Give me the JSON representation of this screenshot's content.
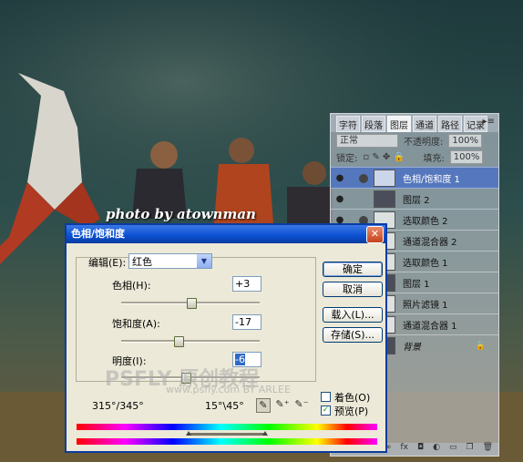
{
  "photo_caption": "photo by atownman",
  "watermark": {
    "brand": "PSFLY 原创教程",
    "url": "www.psfly.com",
    "author": "BY ARLEE"
  },
  "layers_panel": {
    "tabs": [
      "字符",
      "段落",
      "图层",
      "通道",
      "路径",
      "记录"
    ],
    "blend_mode": "正常",
    "opacity_label": "不透明度:",
    "opacity_value": "100%",
    "lock_label": "锁定:",
    "fill_label": "填充:",
    "fill_value": "100%",
    "layers": [
      {
        "name": "色相/饱和度 1",
        "selected": true
      },
      {
        "name": "图层 2",
        "selected": false
      },
      {
        "name": "选取颜色 2",
        "selected": false
      },
      {
        "name": "通道混合器 2",
        "selected": false
      },
      {
        "name": "选取颜色 1",
        "selected": false
      },
      {
        "name": "图层 1",
        "selected": false
      },
      {
        "name": "照片滤镜 1",
        "selected": false
      },
      {
        "name": "通道混合器 1",
        "selected": false
      },
      {
        "name": "背景",
        "selected": false
      }
    ]
  },
  "dialog": {
    "title": "色相/饱和度",
    "edit_label": "编辑(E):",
    "edit_value": "红色",
    "hue_label": "色相(H):",
    "hue_value": "+3",
    "hue_position": 0.508,
    "saturation_label": "饱和度(A):",
    "saturation_value": "-17",
    "saturation_position": 0.415,
    "lightness_label": "明度(I):",
    "lightness_value": "-6",
    "lightness_position": 0.47,
    "buttons": {
      "ok": "确定",
      "cancel": "取消",
      "load": "载入(L)...",
      "save": "存储(S)..."
    },
    "colorize_label": "着色(O)",
    "colorize_checked": false,
    "preview_label": "预览(P)",
    "preview_checked": true,
    "range_left": "315°/345°",
    "range_right": "15°\\45°",
    "eyedropper_icons": [
      "eyedropper-icon",
      "eyedropper-plus-icon",
      "eyedropper-minus-icon"
    ]
  }
}
